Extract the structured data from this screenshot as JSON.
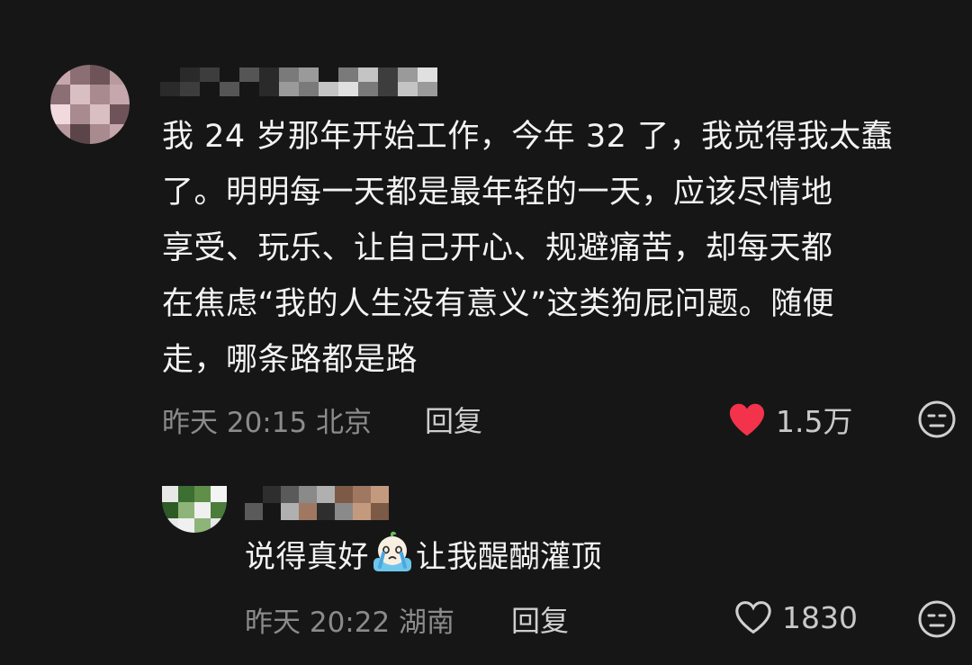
{
  "colors": {
    "background": "#161616",
    "heart_filled": "#f2334b",
    "text_primary": "#f3f3f3",
    "text_secondary": "#8b8b8b"
  },
  "comment": {
    "author_name": "",
    "text_lines": [
      "我 24 岁那年开始工作，今年 32 了，我觉得我太蠢",
      "了。明明每一天都是最年轻的一天，应该尽情地",
      "享受、玩乐、让自己开心、规避痛苦，却每天都",
      "在焦虑“我的人生没有意义”这类狗屁问题。随便",
      "走，哪条路都是路"
    ],
    "meta": "昨天 20:15 北京",
    "reply_label": "回复",
    "likes": "1.5万",
    "liked": true,
    "heart_icon": "heart-filled-icon",
    "reaction_icon": "emoji-face-icon"
  },
  "reply": {
    "author_name": "",
    "text_before": "说得真好",
    "emoji_icon": "crying-emoji-icon",
    "text_after": "让我醍醐灌顶",
    "meta": "昨天 20:22 湖南",
    "reply_label": "回复",
    "likes": "1830",
    "liked": false,
    "heart_icon": "heart-outline-icon",
    "reaction_icon": "emoji-face-icon"
  }
}
